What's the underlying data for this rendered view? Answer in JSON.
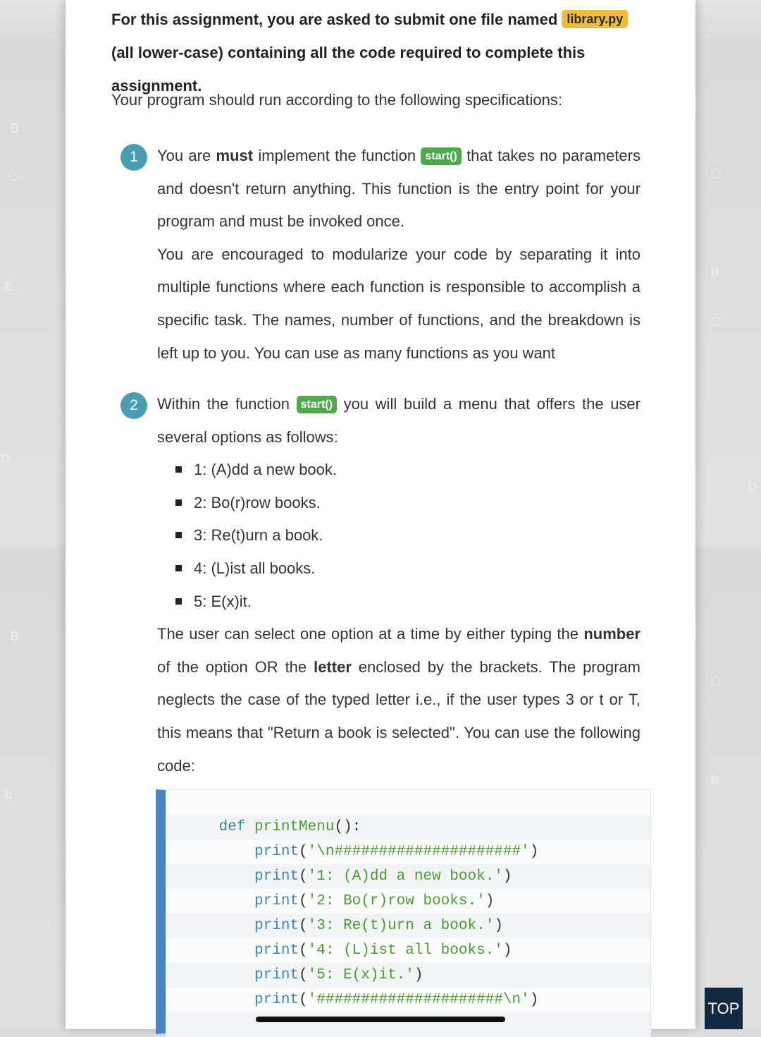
{
  "intro": {
    "text_before": "For this assignment, you are asked to submit one file named ",
    "filename": "library.py",
    "text_after": " (all lower-case) containing all the code required to complete this assignment."
  },
  "spec_intro": "Your program should run according to the following specifications:",
  "items": [
    {
      "number": "1",
      "p1_before": "You are ",
      "p1_bold": "must",
      "p1_mid": " implement the function ",
      "p1_tag": "start()",
      "p1_after": " that takes no parameters and doesn't return anything. This function is the entry point for your program and must be invoked once.",
      "p2": "You are encouraged to modularize your code by separating it into multiple functions where each function is responsible to accomplish a specific task. The names, number of functions, and the breakdown is left up to you. You can use as many functions as you want"
    },
    {
      "number": "2",
      "p1_before": "Within the function ",
      "p1_tag": "start()",
      "p1_after": " you will build a menu that offers the user several options as follows:",
      "options": [
        "1: (A)dd a new book.",
        "2: Bo(r)row books.",
        "3: Re(t)urn a book.",
        "4: (L)ist all books.",
        "5: E(x)it."
      ],
      "p2_a": "The user can select one option at a time by either typing the ",
      "p2_bold1": "number",
      "p2_b": " of the option OR the ",
      "p2_bold2": "letter",
      "p2_c": " enclosed by the brackets. The program neglects the case of the typed letter i.e., if the user types 3 or t or T, this means that \"Return a book is selected\". You can use the following code:"
    }
  ],
  "code": {
    "def_kw": "def",
    "func_name": "printMenu",
    "def_punct": "():",
    "builtin": "print",
    "lines": [
      "'\\n#####################'",
      "'1: (A)dd a new book.'",
      "'2: Bo(r)row books.'",
      "'3: Re(t)urn a book.'",
      "'4: (L)ist all books.'",
      "'5: E(x)it.'",
      "'#####################\\n'"
    ]
  },
  "top_button": "TOP",
  "colors": {
    "filename_tag": "#f0bd3a",
    "function_tag": "#4fa84a",
    "number_badge": "#4a9db1",
    "code_accent": "#4a86c6",
    "top_button": "#12293f"
  }
}
